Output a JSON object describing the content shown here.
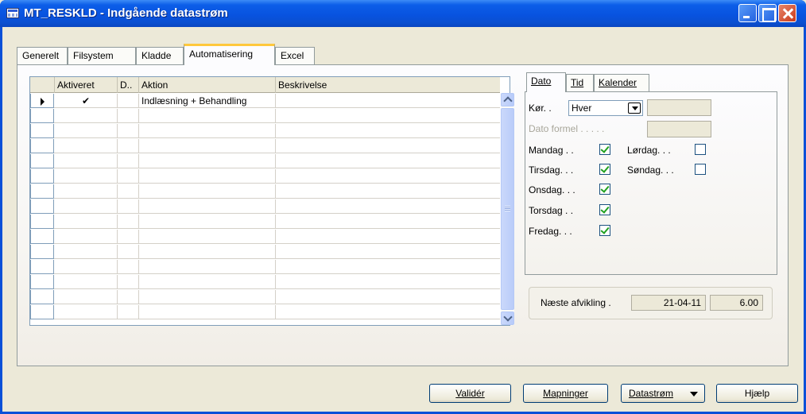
{
  "window": {
    "title": "MT_RESKLD - Indgående datastrøm"
  },
  "tabs": [
    "Generelt",
    "Filsystem",
    "Kladde",
    "Automatisering",
    "Excel"
  ],
  "active_tab": "Automatisering",
  "grid": {
    "columns": [
      "Aktiveret",
      "D..",
      "Aktion",
      "Beskrivelse"
    ],
    "rows": [
      {
        "aktiveret": "✔",
        "d": "",
        "aktion": "Indlæsning + Behandling",
        "beskrivelse": ""
      }
    ]
  },
  "schedule": {
    "tabs": [
      "Dato",
      "Tid",
      "Kalender"
    ],
    "active_tab": "Dato",
    "kor_label": "Kør. .",
    "kor_value": "Hver",
    "dato_formel_label": "Dato formel . . . . .",
    "days": [
      {
        "label": "Mandag . .",
        "checked": true
      },
      {
        "label": "Lørdag. . .",
        "checked": false
      },
      {
        "label": "Tirsdag. . .",
        "checked": true
      },
      {
        "label": "Søndag. . .",
        "checked": false
      },
      {
        "label": "Onsdag. . .",
        "checked": true
      },
      {
        "label": "Torsdag . .",
        "checked": true
      },
      {
        "label": "Fredag. . .",
        "checked": true
      }
    ],
    "next_run_label": "Næste afvikling .",
    "next_run_date": "21-04-11",
    "next_run_time": "6.00"
  },
  "buttons": {
    "valider": "Validér",
    "mapninger": "Mapninger",
    "datastrom": "Datastrøm",
    "hjaelp": "Hjælp"
  }
}
